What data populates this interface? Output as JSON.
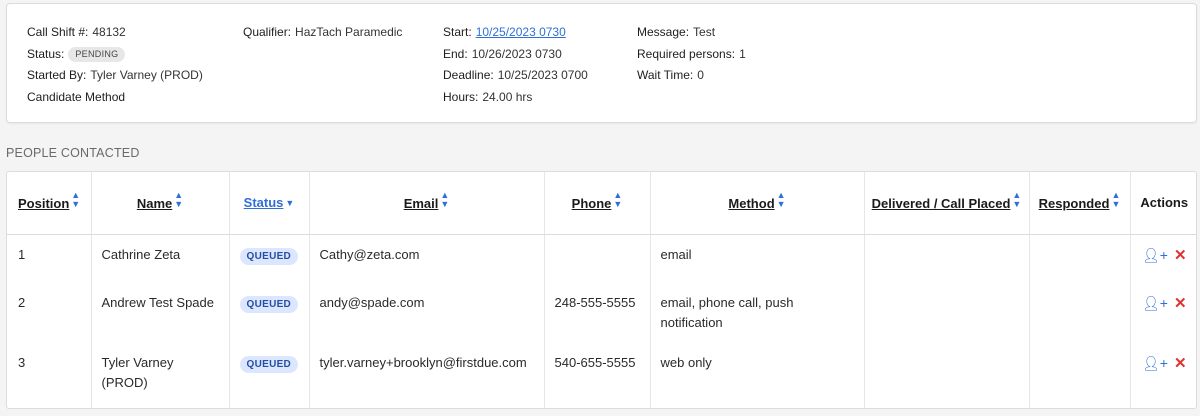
{
  "summary": {
    "col1": {
      "call_shift_label": "Call Shift #:",
      "call_shift_value": "48132",
      "status_label": "Status:",
      "status_value": "PENDING",
      "started_by_label": "Started By:",
      "started_by_value": "Tyler Varney (PROD)",
      "candidate_method_label": "Candidate Method"
    },
    "col2": {
      "qualifier_label": "Qualifier:",
      "qualifier_value": "HazTach Paramedic"
    },
    "col3": {
      "start_label": "Start:",
      "start_value": "10/25/2023 0730",
      "end_label": "End:",
      "end_value": "10/26/2023 0730",
      "deadline_label": "Deadline:",
      "deadline_value": "10/25/2023 0700",
      "hours_label": "Hours:",
      "hours_value": "24.00 hrs"
    },
    "col4": {
      "message_label": "Message:",
      "message_value": "Test",
      "required_label": "Required persons:",
      "required_value": "1",
      "wait_label": "Wait Time:",
      "wait_value": "0"
    }
  },
  "people": {
    "section_title": "PEOPLE CONTACTED",
    "headers": {
      "position": "Position",
      "name": "Name",
      "status": "Status",
      "email": "Email",
      "phone": "Phone",
      "method": "Method",
      "delivered": "Delivered / Call Placed",
      "responded": "Responded",
      "actions": "Actions"
    },
    "rows": [
      {
        "position": "1",
        "name": "Cathrine Zeta",
        "status": "QUEUED",
        "email": "Cathy@zeta.com",
        "phone": "",
        "method": "email",
        "delivered": "",
        "responded": ""
      },
      {
        "position": "2",
        "name": "Andrew Test Spade",
        "status": "QUEUED",
        "email": "andy@spade.com",
        "phone": "248-555-5555",
        "method": "email, phone call, push notification",
        "delivered": "",
        "responded": ""
      },
      {
        "position": "3",
        "name": "Tyler Varney (PROD)",
        "status": "QUEUED",
        "email": "tyler.varney+brooklyn@firstdue.com",
        "phone": "540-655-5555",
        "method": "web only",
        "delivered": "",
        "responded": ""
      }
    ],
    "row_icons": [
      "add-user-icon",
      "close-icon"
    ]
  },
  "colors": {
    "accent": "#2f6fd8",
    "danger": "#dd3333",
    "badge_bg": "#dce7ff"
  }
}
